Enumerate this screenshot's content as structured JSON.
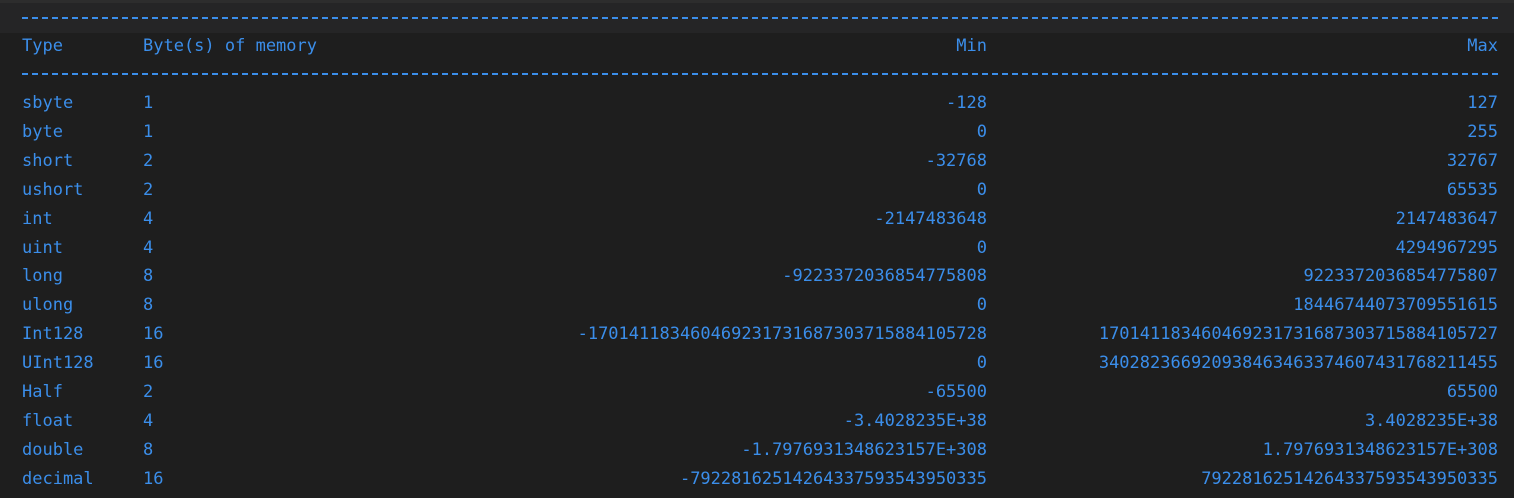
{
  "colors": {
    "background": "#1e1e1e",
    "text": "#3b8eea",
    "top_band": "#252526"
  },
  "table": {
    "headers": {
      "type": "Type",
      "bytes": "Byte(s) of memory",
      "min": "Min",
      "max": "Max"
    },
    "rows": [
      {
        "type": "sbyte",
        "bytes": "1",
        "min": "-128",
        "max": "127"
      },
      {
        "type": "byte",
        "bytes": "1",
        "min": "0",
        "max": "255"
      },
      {
        "type": "short",
        "bytes": "2",
        "min": "-32768",
        "max": "32767"
      },
      {
        "type": "ushort",
        "bytes": "2",
        "min": "0",
        "max": "65535"
      },
      {
        "type": "int",
        "bytes": "4",
        "min": "-2147483648",
        "max": "2147483647"
      },
      {
        "type": "uint",
        "bytes": "4",
        "min": "0",
        "max": "4294967295"
      },
      {
        "type": "long",
        "bytes": "8",
        "min": "-9223372036854775808",
        "max": "9223372036854775807"
      },
      {
        "type": "ulong",
        "bytes": "8",
        "min": "0",
        "max": "18446744073709551615"
      },
      {
        "type": "Int128",
        "bytes": "16",
        "min": "-170141183460469231731687303715884105728",
        "max": "170141183460469231731687303715884105727"
      },
      {
        "type": "UInt128",
        "bytes": "16",
        "min": "0",
        "max": "340282366920938463463374607431768211455"
      },
      {
        "type": "Half",
        "bytes": "2",
        "min": "-65500",
        "max": "65500"
      },
      {
        "type": "float",
        "bytes": "4",
        "min": "-3.4028235E+38",
        "max": "3.4028235E+38"
      },
      {
        "type": "double",
        "bytes": "8",
        "min": "-1.7976931348623157E+308",
        "max": "1.7976931348623157E+308"
      },
      {
        "type": "decimal",
        "bytes": "16",
        "min": "-79228162514264337593543950335",
        "max": "79228162514264337593543950335"
      }
    ]
  }
}
